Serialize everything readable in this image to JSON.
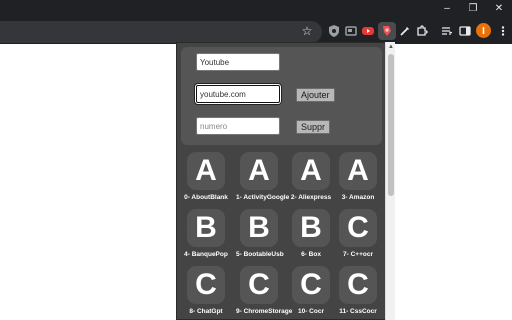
{
  "browser": {
    "window_controls": {
      "minimize": "–",
      "restore": "❐",
      "close": "✕"
    },
    "bookmark_star": "☆",
    "extensions": [
      {
        "name": "shield-extension",
        "color": "#9aa0a6"
      },
      {
        "name": "screen-extension",
        "color": "#9aa0a6"
      },
      {
        "name": "youtube-extension",
        "color": "#e53935"
      },
      {
        "name": "active-extension",
        "color": "#ef5350"
      },
      {
        "name": "eyedropper-extension",
        "color": "#e8eaed"
      },
      {
        "name": "puzzle-extension",
        "color": "#e8eaed"
      }
    ],
    "profile_color": "#e8710a"
  },
  "form": {
    "name_value": "Youtube",
    "url_value": "youtube.com",
    "add_button": "Ajouter",
    "number_placeholder": "numero",
    "delete_button": "Suppr"
  },
  "shortcuts": [
    {
      "letter": "A",
      "label": "0- AboutBlank"
    },
    {
      "letter": "A",
      "label": "1- ActivityGoogle"
    },
    {
      "letter": "A",
      "label": "2- Aliexpress"
    },
    {
      "letter": "A",
      "label": "3- Amazon"
    },
    {
      "letter": "B",
      "label": "4- BanquePop"
    },
    {
      "letter": "B",
      "label": "5- BootableUsb"
    },
    {
      "letter": "B",
      "label": "6- Box"
    },
    {
      "letter": "C",
      "label": "7- C++ocr"
    },
    {
      "letter": "C",
      "label": "8- ChatGpt"
    },
    {
      "letter": "C",
      "label": "9- ChromeStorage"
    },
    {
      "letter": "C",
      "label": "10- Cocr"
    },
    {
      "letter": "C",
      "label": "11- CssCocr"
    }
  ],
  "colors": {
    "chrome_bg": "#202124",
    "popup_bg": "#444444",
    "panel_bg": "#555555",
    "tile_bg": "#555555"
  }
}
